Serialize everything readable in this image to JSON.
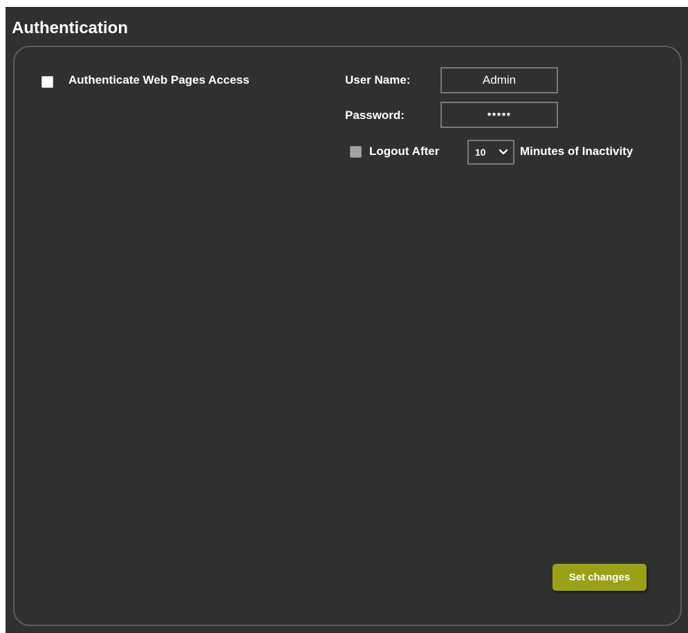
{
  "header": {
    "title": "Authentication"
  },
  "auth": {
    "authenticate_label": "Authenticate Web Pages Access",
    "authenticate_checked": false,
    "username_label": "User Name:",
    "username_value": "Admin",
    "password_label": "Password:",
    "password_value": "•••••",
    "logout_label": "Logout After",
    "logout_checked": false,
    "logout_minutes": "10",
    "inactivity_label": "Minutes of Inactivity"
  },
  "actions": {
    "set_changes_label": "Set changes"
  },
  "colors": {
    "background": "#303030",
    "panel_border": "#5d5d5d",
    "button": "#9aa118",
    "text": "#ffffff"
  }
}
